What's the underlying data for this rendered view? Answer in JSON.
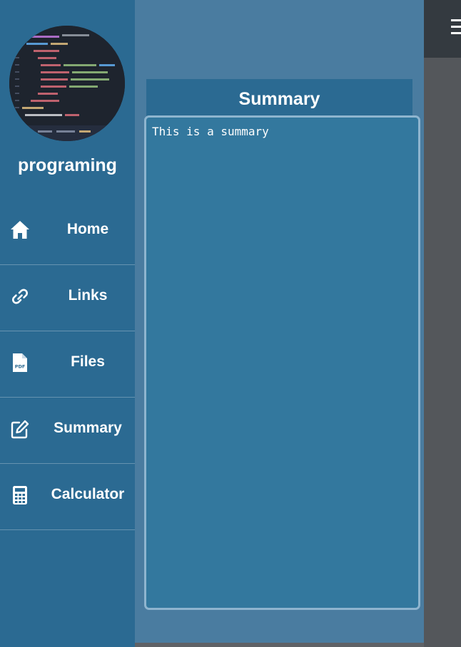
{
  "sidebar": {
    "user_name": "programing",
    "items": [
      {
        "label": "Home",
        "icon": "home-icon"
      },
      {
        "label": "Links",
        "icon": "link-icon"
      },
      {
        "label": "Files",
        "icon": "pdf-file-icon",
        "icon_text": "PDF"
      },
      {
        "label": "Summary",
        "icon": "edit-icon"
      },
      {
        "label": "Calculator",
        "icon": "calculator-icon"
      }
    ]
  },
  "main": {
    "panel_title": "Summary",
    "summary_text": "This is a summary"
  },
  "header": {
    "menu_icon": "hamburger-icon"
  },
  "colors": {
    "sidebar_bg": "#2b6a92",
    "main_bg": "#4a7ca0",
    "editor_bg": "#33789e",
    "topbar_bg": "#343a40"
  }
}
